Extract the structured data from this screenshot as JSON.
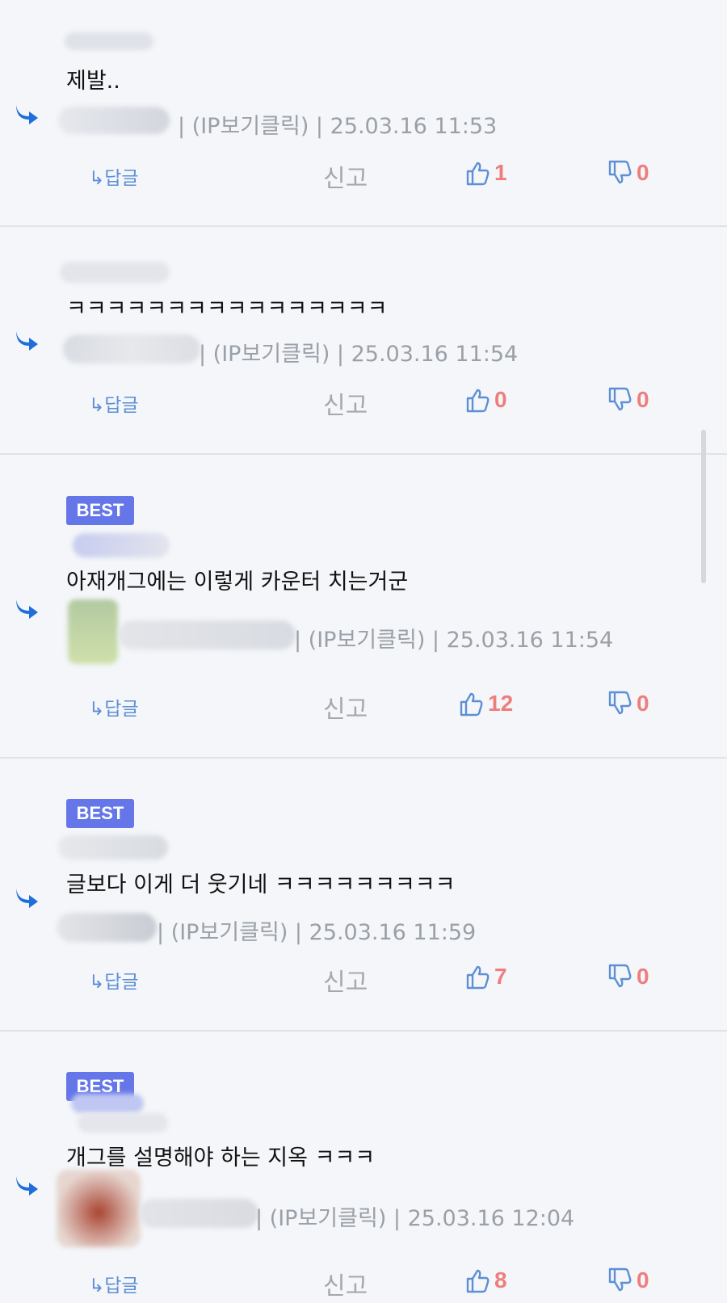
{
  "comments": [
    {
      "best_label": "",
      "text": "제발..",
      "meta": "| (IP보기클릭) | 25.03.16 11:53",
      "reply": "↳답글",
      "report": "신고",
      "likes": "1",
      "dislikes": "0"
    },
    {
      "best_label": "",
      "text": "ㅋㅋㅋㅋㅋㅋㅋㅋㅋㅋㅋㅋㅋㅋㅋㅋ",
      "meta": "| (IP보기클릭) | 25.03.16 11:54",
      "reply": "↳답글",
      "report": "신고",
      "likes": "0",
      "dislikes": "0"
    },
    {
      "best_label": "BEST",
      "text": "아재개그에는 이렇게 카운터 치는거군",
      "meta": "| (IP보기클릭) | 25.03.16 11:54",
      "reply": "↳답글",
      "report": "신고",
      "likes": "12",
      "dislikes": "0"
    },
    {
      "best_label": "BEST",
      "text": "글보다 이게 더 웃기네 ㅋㅋㅋㅋㅋㅋㅋㅋㅋ",
      "meta": "| (IP보기클릭) | 25.03.16 11:59",
      "reply": "↳답글",
      "report": "신고",
      "likes": "7",
      "dislikes": "0"
    },
    {
      "best_label": "BEST",
      "text": "개그를 설명해야 하는 지옥 ㅋㅋㅋ",
      "meta": "| (IP보기클릭) | 25.03.16 12:04",
      "reply": "↳답글",
      "report": "신고",
      "likes": "8",
      "dislikes": "0"
    }
  ],
  "colors": {
    "accent": "#6577e8",
    "like_icon": "#5c8fd6",
    "count": "#ee7e7e",
    "reply_arrow": "#1e6fd9"
  },
  "icons": {
    "reply_arrow": "reply-arrow-icon",
    "like": "thumbs-up-icon",
    "dislike": "thumbs-down-icon"
  }
}
